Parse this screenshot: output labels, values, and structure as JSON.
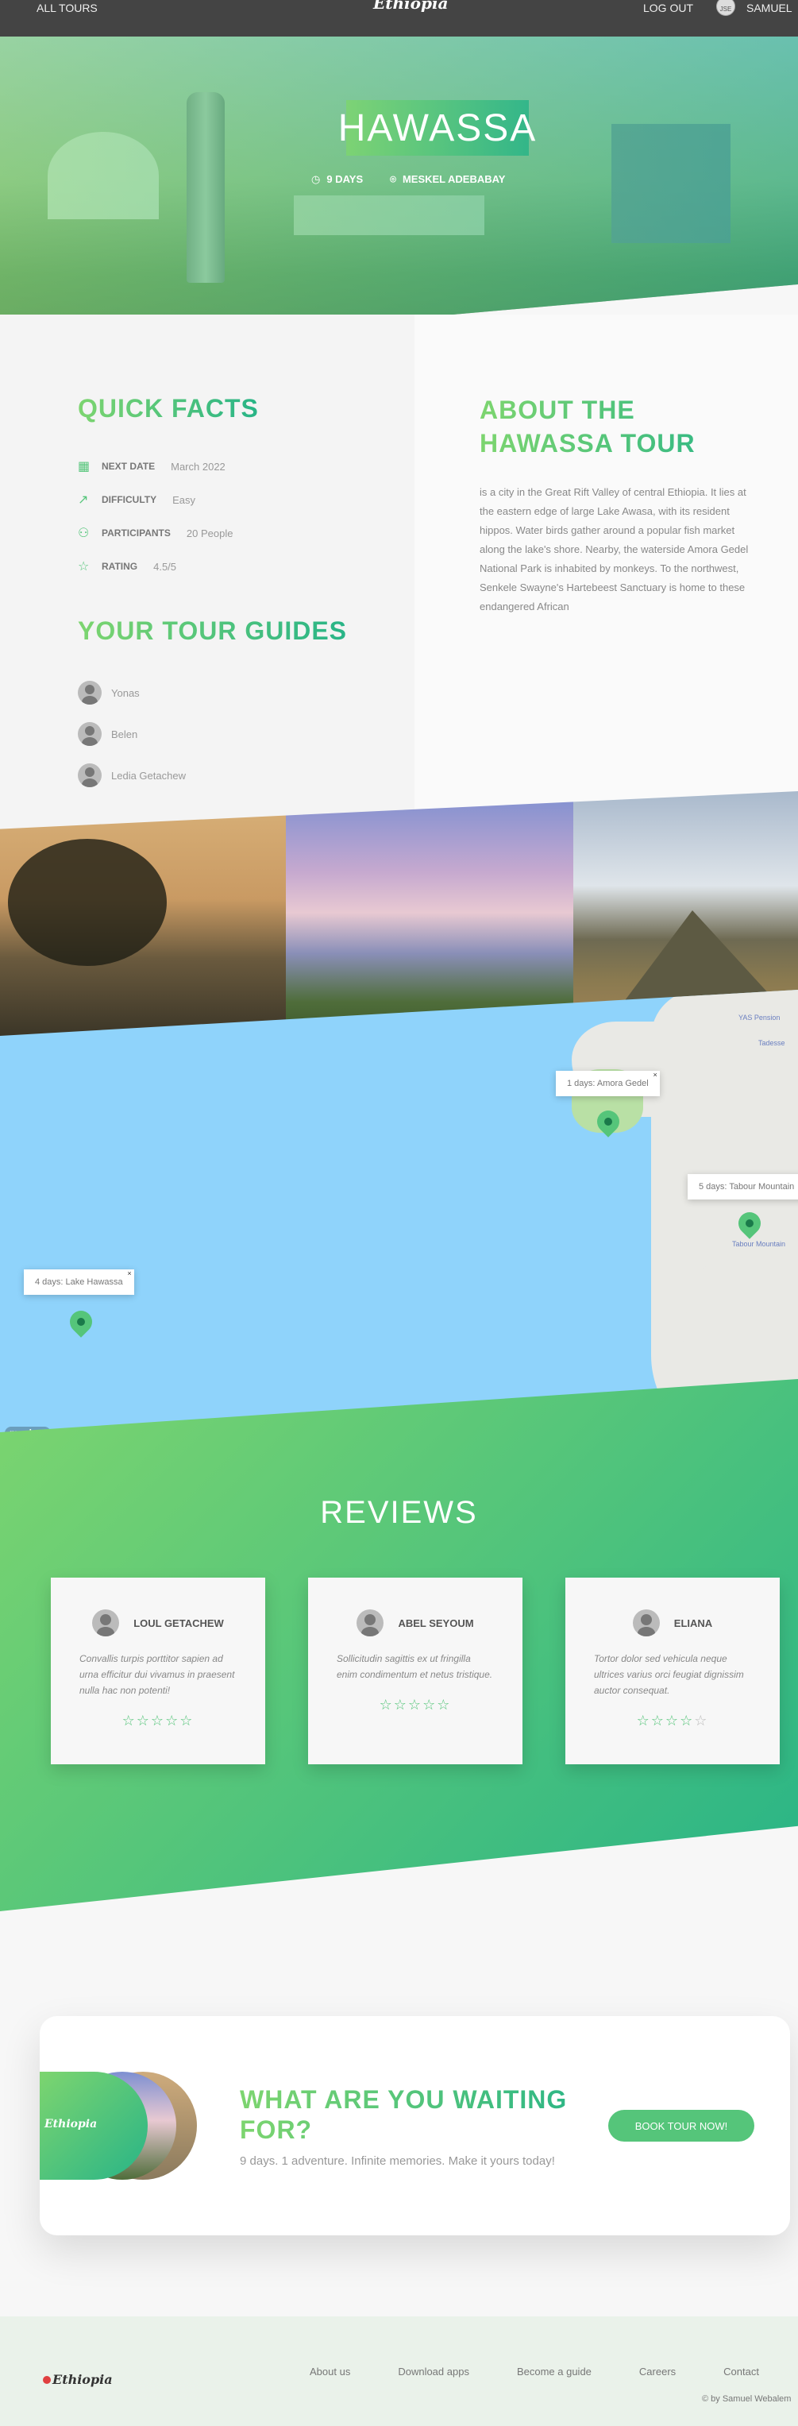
{
  "header": {
    "all_tours": "ALL TOURS",
    "logo": "Ethiopia",
    "logout": "LOG OUT",
    "user_avatar_alt": "JSE",
    "user_name": "SAMUEL"
  },
  "hero": {
    "title": "HAWASSA",
    "duration": "9 DAYS",
    "start_location": "MESKEL ADEBABAY"
  },
  "quick_facts": {
    "title": "QUICK FACTS",
    "items": [
      {
        "icon": "calendar-icon",
        "label": "NEXT DATE",
        "value": "March 2022"
      },
      {
        "icon": "trending-up-icon",
        "label": "DIFFICULTY",
        "value": "Easy"
      },
      {
        "icon": "user-icon",
        "label": "PARTICIPANTS",
        "value": "20 People"
      },
      {
        "icon": "star-icon",
        "label": "RATING",
        "value": "4.5/5"
      }
    ]
  },
  "guides": {
    "title": "YOUR TOUR GUIDES",
    "items": [
      {
        "name": "Yonas"
      },
      {
        "name": "Belen"
      },
      {
        "name": "Ledia Getachew"
      }
    ]
  },
  "about": {
    "title": "ABOUT THE HAWASSA TOUR",
    "text": "is a city in the Great Rift Valley of central Ethiopia. It lies at the eastern edge of large Lake Awasa, with its resident hippos. Water birds gather around a popular fish market along the lake's shore. Nearby, the waterside Amora Gedel National Park is inhabited by monkeys. To the northwest, Senkele Swayne's Hartebeest Sanctuary is home to these endangered African"
  },
  "map": {
    "popups": [
      {
        "text": "1 days: Amora Gedel"
      },
      {
        "text": "5 days: Tabour Mountain"
      },
      {
        "text": "4 days: Lake Hawassa"
      }
    ],
    "labels": [
      "YAS Pension",
      "Tadesse",
      "Tabour Mountain"
    ],
    "attribution": "mapbox",
    "colors": {
      "water": "#8fd3fb",
      "land": "#e9e9e5",
      "pin": "#55c57a"
    }
  },
  "reviews": {
    "title": "REVIEWS",
    "items": [
      {
        "name": "LOUL GETACHEW",
        "text": "Convallis turpis porttitor sapien ad urna efficitur dui vivamus in praesent nulla hac non potenti!",
        "rating": 5
      },
      {
        "name": "ABEL SEYOUM",
        "text": "Sollicitudin sagittis ex ut fringilla enim condimentum et netus tristique.",
        "rating": 5
      },
      {
        "name": "ELIANA",
        "text": "Tortor dolor sed vehicula neque ultrices varius orci feugiat dignissim auctor consequat.",
        "rating": 4
      }
    ]
  },
  "cta": {
    "logo": "Ethiopia",
    "title": "WHAT ARE YOU WAITING FOR?",
    "text": "9 days. 1 adventure. Infinite memories. Make it yours today!",
    "button": "BOOK TOUR NOW!"
  },
  "footer": {
    "logo": "Ethiopia",
    "links": [
      "About us",
      "Download apps",
      "Become a guide",
      "Careers",
      "Contact"
    ],
    "copyright": "© by Samuel Webalem"
  },
  "colors": {
    "accent": "#55c57a",
    "gradient_start": "#7dd56f",
    "gradient_end": "#28b487",
    "header_bg": "#444444"
  }
}
